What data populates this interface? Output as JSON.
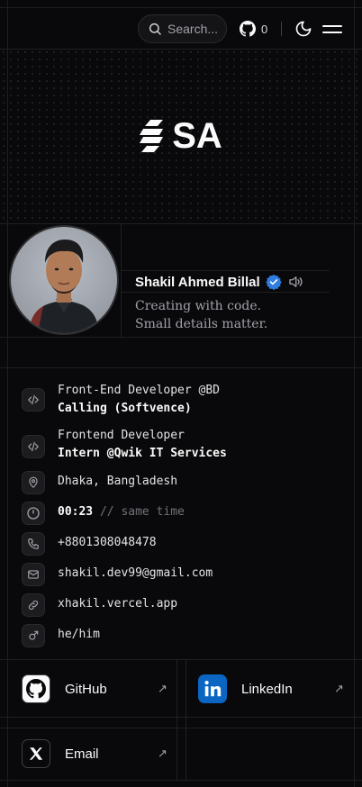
{
  "header": {
    "search_placeholder": "Search...",
    "github_stars": "0"
  },
  "banner": {
    "logo_text": "SA"
  },
  "profile": {
    "name": "Shakil Ahmed Billal",
    "tagline_line1": "Creating with code.",
    "tagline_line2": "Small details matter."
  },
  "info": {
    "job1_line1": "Front-End Developer @BD",
    "job1_line2": "Calling (Softvence)",
    "job2_line1": "Frontend Developer",
    "job2_line2": "Intern @Qwik IT Services",
    "location": "Dhaka, Bangladesh",
    "time": "00:23",
    "time_note": "// same time",
    "phone": "+8801308048478",
    "email": "shakil.dev99@gmail.com",
    "website": "xhakil.vercel.app",
    "pronouns": "he/him"
  },
  "socials": {
    "github": "GitHub",
    "linkedin": "LinkedIn",
    "email": "Email"
  },
  "colors": {
    "background": "#09090b",
    "accent_blue": "#2f7de1",
    "linkedin_blue": "#0a66c2"
  }
}
